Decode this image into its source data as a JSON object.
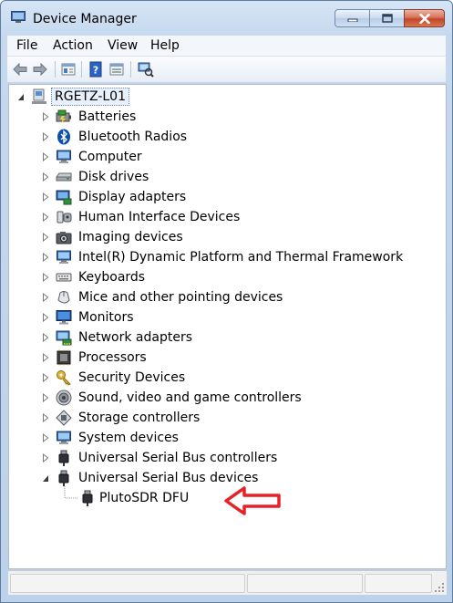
{
  "window": {
    "title": "Device Manager"
  },
  "menu": [
    "File",
    "Action",
    "View",
    "Help"
  ],
  "toolbar": {
    "icons": [
      "back-arrow-icon",
      "forward-arrow-icon",
      "properties-sheet-icon",
      "help-icon",
      "show-hidden-icon",
      "scan-hardware-icon"
    ]
  },
  "tree": {
    "root": "RGETZ-L01",
    "categories": [
      {
        "label": "Batteries",
        "icon": "battery-icon"
      },
      {
        "label": "Bluetooth Radios",
        "icon": "bluetooth-icon"
      },
      {
        "label": "Computer",
        "icon": "computer-icon"
      },
      {
        "label": "Disk drives",
        "icon": "disk-drive-icon"
      },
      {
        "label": "Display adapters",
        "icon": "display-adapter-icon"
      },
      {
        "label": "Human Interface Devices",
        "icon": "hid-icon"
      },
      {
        "label": "Imaging devices",
        "icon": "camera-icon"
      },
      {
        "label": "Intel(R) Dynamic Platform and Thermal Framework",
        "icon": "computer-icon"
      },
      {
        "label": "Keyboards",
        "icon": "keyboard-icon"
      },
      {
        "label": "Mice and other pointing devices",
        "icon": "mouse-icon"
      },
      {
        "label": "Monitors",
        "icon": "monitor-icon"
      },
      {
        "label": "Network adapters",
        "icon": "network-adapter-icon"
      },
      {
        "label": "Processors",
        "icon": "processor-icon"
      },
      {
        "label": "Security Devices",
        "icon": "key-icon"
      },
      {
        "label": "Sound, video and game controllers",
        "icon": "speaker-icon"
      },
      {
        "label": "Storage controllers",
        "icon": "storage-controller-icon"
      },
      {
        "label": "System devices",
        "icon": "computer-icon"
      },
      {
        "label": "Universal Serial Bus controllers",
        "icon": "usb-plug-icon"
      },
      {
        "label": "Universal Serial Bus devices",
        "icon": "usb-plug-icon",
        "expanded": true
      }
    ],
    "child": {
      "label": "PlutoSDR DFU",
      "icon": "usb-plug-icon"
    }
  },
  "colors": {
    "annotation_arrow": "#e8202a",
    "selection": "#e8f0fb"
  }
}
